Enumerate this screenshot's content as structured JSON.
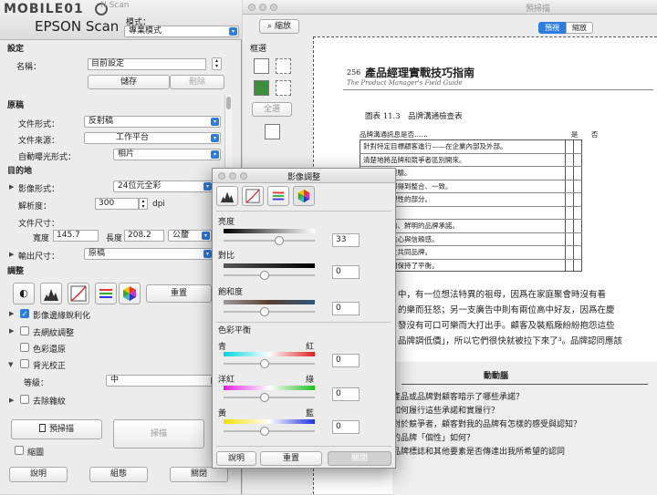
{
  "epson": {
    "logo_text": "MOBILE01",
    "app_name": "EPSON Scan",
    "title_faded": "N Scan",
    "mode_label": "模式：",
    "mode_value": "專業模式",
    "settings": {
      "section": "設定",
      "name_label": "名稱：",
      "name_value": "目前設定",
      "save_btn": "儲存",
      "delete_btn": "刪除"
    },
    "original": {
      "section": "原稿",
      "doc_type_label": "文件形式：",
      "doc_type_value": "反射稿",
      "doc_source_label": "文件來源：",
      "doc_source_value": "工作平台",
      "auto_exposure_label": "自動曝光形式：",
      "auto_exposure_value": "相片"
    },
    "destination": {
      "section": "目的地",
      "image_type_label": "影像形式：",
      "image_type_value": "24位元全彩",
      "resolution_label": "解析度：",
      "resolution_value": "300",
      "dpi": "dpi",
      "doc_size_label": "文件尺寸：",
      "width_label": "寬度",
      "width_value": "145.7",
      "height_label": "長度",
      "height_value": "208.2",
      "unit_value": "公釐",
      "output_size_label": "輸出尺寸：",
      "output_size_value": "原稿"
    },
    "adjust": {
      "section": "調整",
      "reset_btn": "重置",
      "unsharp": "影像邊緣銳利化",
      "descreen": "去網紋調整",
      "color_restore": "色彩還原",
      "backlight": "背光校正",
      "level_label": "等級：",
      "level_value": "中",
      "dust": "去除雜紋"
    },
    "preview_btn": "預掃描",
    "scan_btn": "掃描",
    "thumbnail": "縮圖",
    "help_btn": "說明",
    "config_btn": "組態",
    "close_btn": "關閉"
  },
  "preview": {
    "title": "預掃描",
    "zoom_btn": "縮放",
    "tab_preview": "預視",
    "tab_thumb": "縮放",
    "marquee_label": "框選",
    "all_btn": "全選",
    "doc": {
      "page_num": "256",
      "book_title": "產品經理實戰技巧指南",
      "book_subtitle": "The Product Manager's Field Guide",
      "table_title": "圖表 11.3　品牌溝通檢查表",
      "col_header": "品牌溝通訊息是否……",
      "col_yes": "是",
      "col_no": "否",
      "rows": [
        "針對特定目標顧客進行——在企業內部及外部。",
        "清楚地將品牌和競爭者區別開來。",
        "說的顧客經驗。",
        "有關媒體都得到整合、一致。",
        "有感性和理性的部分。",
        "價值。",
        "令人難忘的、鮮明的品牌承諾。",
        "承諾建立信心與信賴感。",
        "的機構建立共同品牌。",
        "和屬性之間保持了平衡。"
      ],
      "para": [
        "中，有一位想法特異的祖母，因爲在家庭聚會時沒有看",
        "的樂而狂怒；另一支廣告中則有兩位高中好友，因爲在慶",
        "發沒有可口可樂而大打出手。顧客及裝瓶廠紛紛抱怨這些",
        "品牌調低價」，所以它們很快就被拉下來了³。品牌認同應該"
      ],
      "box_title": "動動腦",
      "box_lines": [
        "產品或品牌對顧客暗示了哪些承諾？",
        "如何履行這些承諾和實履行？",
        "對於競爭者，顧客對我的品牌有怎樣的感受與認知？",
        "的品牌「個性」如何？",
        "品牌標誌和其他要素是否傳達出我所希望的認同",
        "？"
      ]
    }
  },
  "adjust": {
    "title": "影像調整",
    "brightness_label": "亮度",
    "brightness_value": "33",
    "contrast_label": "對比",
    "contrast_value": "0",
    "saturation_label": "飽和度",
    "saturation_value": "0",
    "color_balance_label": "色彩平衡",
    "cyan": "青",
    "red": "紅",
    "cr_value": "0",
    "magenta": "洋紅",
    "green": "綠",
    "mg_value": "0",
    "yellow": "黃",
    "blue": "藍",
    "yb_value": "0",
    "help_btn": "說明",
    "reset_btn": "重置",
    "close_btn": "關閉"
  },
  "colors": {
    "accent": "#2d7de0"
  }
}
